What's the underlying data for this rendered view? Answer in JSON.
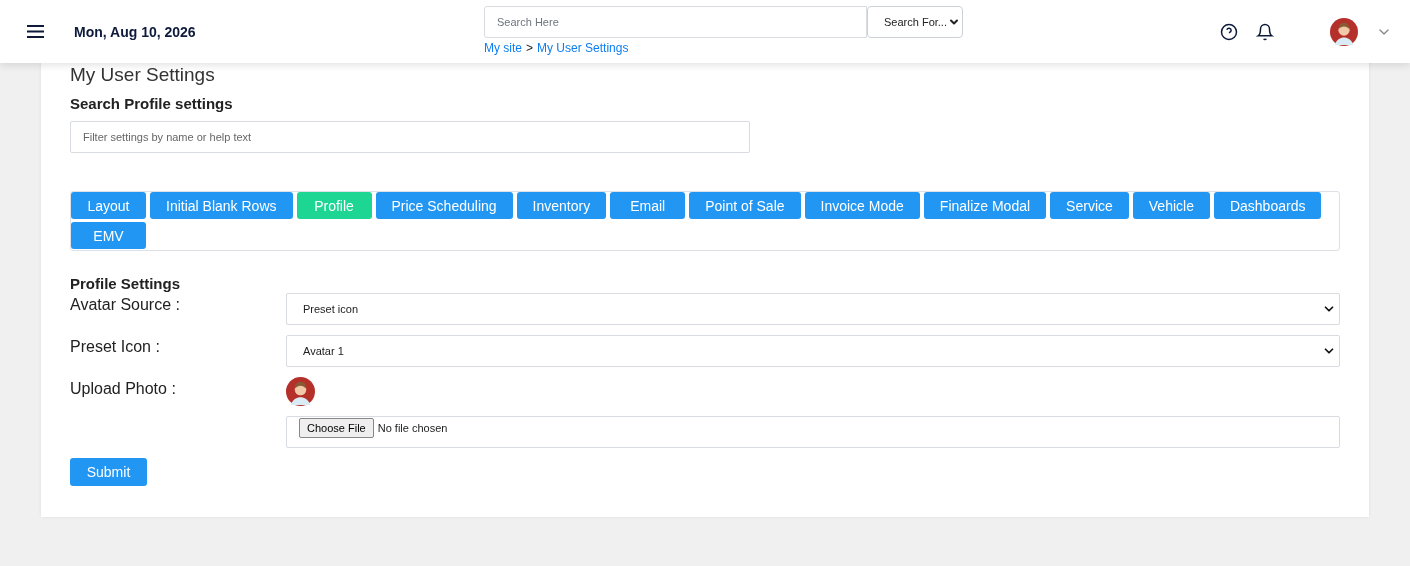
{
  "header": {
    "date": "Mon, Aug 10, 2026",
    "search": {
      "placeholder": "Search Here"
    },
    "search_for": "Search For...",
    "breadcrumb": [
      {
        "label": "My site"
      },
      {
        "label": "My User Settings"
      }
    ],
    "breadcrumb_separator": ">"
  },
  "page_title": "My User Settings",
  "search_settings": {
    "heading": "Search Profile settings",
    "placeholder": "Filter settings by name or help text"
  },
  "tabs": [
    {
      "label": "Layout",
      "selected": false
    },
    {
      "label": "Initial Blank Rows",
      "selected": false
    },
    {
      "label": "Profile",
      "selected": true
    },
    {
      "label": "Price Scheduling",
      "selected": false
    },
    {
      "label": "Inventory",
      "selected": false
    },
    {
      "label": "Email",
      "selected": false
    },
    {
      "label": "Point of Sale",
      "selected": false
    },
    {
      "label": "Invoice Mode",
      "selected": false
    },
    {
      "label": "Finalize Modal",
      "selected": false
    },
    {
      "label": "Service",
      "selected": false
    },
    {
      "label": "Vehicle",
      "selected": false
    },
    {
      "label": "Dashboards",
      "selected": false
    },
    {
      "label": "EMV",
      "selected": false
    }
  ],
  "section_heading": "Profile Settings",
  "fields": [
    {
      "kind": "select",
      "label": "Avatar Source :",
      "value": "Preset icon"
    },
    {
      "kind": "select",
      "label": "Preset Icon :",
      "value": "Avatar 1"
    },
    {
      "kind": "upload",
      "label": "Upload Photo :",
      "button": "Choose File",
      "status": "No file chosen"
    }
  ],
  "submit": "Submit"
}
